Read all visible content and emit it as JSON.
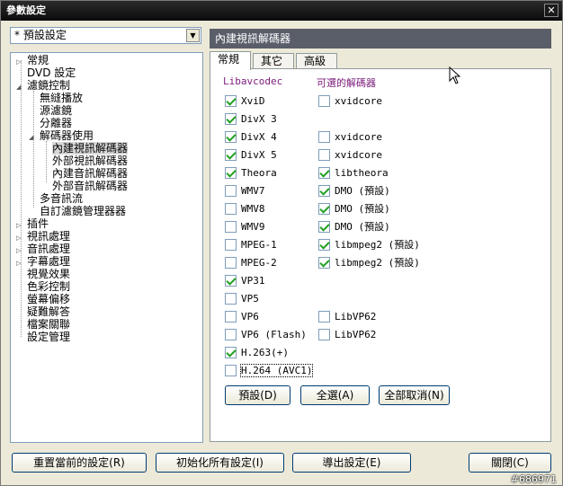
{
  "window": {
    "title": "參數設定",
    "close": "✕"
  },
  "preset": {
    "value": "* 預設設定"
  },
  "tree": {
    "items": [
      {
        "label": "常規",
        "twisty": "▷"
      },
      {
        "label": "DVD 設定",
        "twisty": ""
      },
      {
        "label": "濾鏡控制",
        "twisty": "◢"
      },
      {
        "label": "無縫播放",
        "twisty": ""
      },
      {
        "label": "源濾鏡",
        "twisty": ""
      },
      {
        "label": "分離器",
        "twisty": ""
      },
      {
        "label": "解碼器使用",
        "twisty": "◢"
      },
      {
        "label": "內建視訊解碼器",
        "twisty": ""
      },
      {
        "label": "外部視訊解碼器",
        "twisty": ""
      },
      {
        "label": "內建音訊解碼器",
        "twisty": ""
      },
      {
        "label": "外部音訊解碼器",
        "twisty": ""
      },
      {
        "label": "多音訊流",
        "twisty": ""
      },
      {
        "label": "自訂濾鏡管理器器",
        "twisty": ""
      },
      {
        "label": "插件",
        "twisty": "▷"
      },
      {
        "label": "視訊處理",
        "twisty": "▷"
      },
      {
        "label": "音訊處理",
        "twisty": "▷"
      },
      {
        "label": "字幕處理",
        "twisty": "▷"
      },
      {
        "label": "視覺效果",
        "twisty": ""
      },
      {
        "label": "色彩控制",
        "twisty": ""
      },
      {
        "label": "螢幕偏移",
        "twisty": ""
      },
      {
        "label": "疑難解答",
        "twisty": ""
      },
      {
        "label": "檔案關聯",
        "twisty": ""
      },
      {
        "label": "設定管理",
        "twisty": ""
      }
    ]
  },
  "panel": {
    "title": "內建視訊解碼器"
  },
  "tabs": [
    {
      "label": "常規"
    },
    {
      "label": "其它"
    },
    {
      "label": "高級"
    }
  ],
  "columns": {
    "left": "Libavcodec",
    "right": "可選的解碼器"
  },
  "rows": [
    {
      "left": {
        "label": "XviD",
        "checked": true
      },
      "right": {
        "label": "xvidcore",
        "checked": false
      }
    },
    {
      "left": {
        "label": "DivX 3",
        "checked": true
      },
      "right": null
    },
    {
      "left": {
        "label": "DivX 4",
        "checked": true
      },
      "right": {
        "label": "xvidcore",
        "checked": false
      }
    },
    {
      "left": {
        "label": "DivX 5",
        "checked": true
      },
      "right": {
        "label": "xvidcore",
        "checked": false
      }
    },
    {
      "left": {
        "label": "Theora",
        "checked": true
      },
      "right": {
        "label": "libtheora",
        "checked": true
      }
    },
    {
      "left": {
        "label": "WMV7",
        "checked": false
      },
      "right": {
        "label": "DMO (預設)",
        "checked": true
      }
    },
    {
      "left": {
        "label": "WMV8",
        "checked": false
      },
      "right": {
        "label": "DMO (預設)",
        "checked": true
      }
    },
    {
      "left": {
        "label": "WMV9",
        "checked": false
      },
      "right": {
        "label": "DMO (預設)",
        "checked": true
      }
    },
    {
      "left": {
        "label": "MPEG-1",
        "checked": false
      },
      "right": {
        "label": "libmpeg2 (預設)",
        "checked": true
      }
    },
    {
      "left": {
        "label": "MPEG-2",
        "checked": false
      },
      "right": {
        "label": "libmpeg2 (預設)",
        "checked": true
      }
    },
    {
      "left": {
        "label": "VP31",
        "checked": true
      },
      "right": null
    },
    {
      "left": {
        "label": "VP5",
        "checked": false
      },
      "right": null
    },
    {
      "left": {
        "label": "VP6",
        "checked": false
      },
      "right": {
        "label": "LibVP62",
        "checked": false
      }
    },
    {
      "left": {
        "label": "VP6 (Flash)",
        "checked": false
      },
      "right": {
        "label": "LibVP62",
        "checked": false
      }
    },
    {
      "left": {
        "label": "H.263(+)",
        "checked": true
      },
      "right": null
    },
    {
      "left": {
        "label": "H.264 (AVC1)",
        "checked": false
      },
      "right": null
    }
  ],
  "tab_buttons": {
    "default": "預設(D)",
    "select_all": "全選(A)",
    "clear_all": "全部取消(N)"
  },
  "bottom_buttons": {
    "reset": "重置當前的設定(R)",
    "init_all": "初始化所有設定(I)",
    "export": "導出設定(E)",
    "close": "關閉(C)"
  },
  "watermark": "#686971"
}
